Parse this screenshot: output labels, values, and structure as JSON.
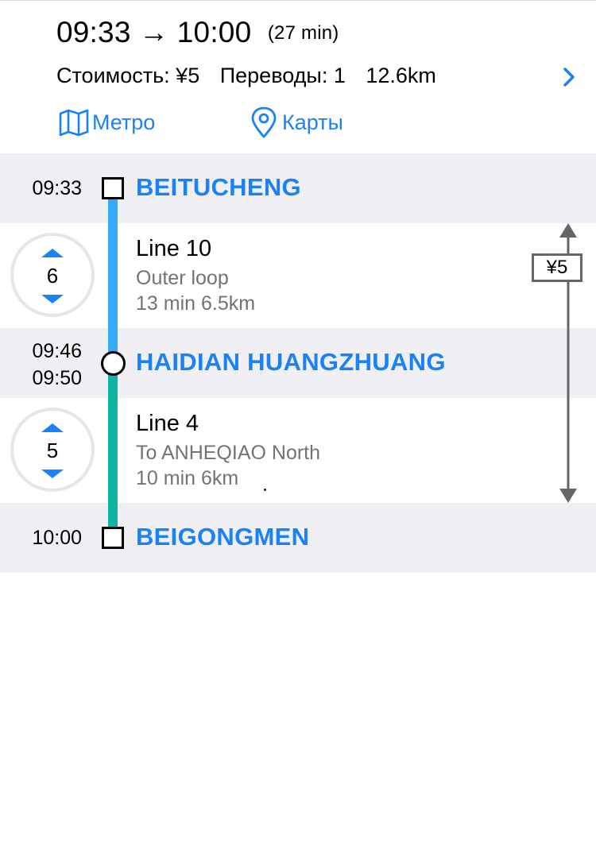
{
  "summary": {
    "departure": "09:33",
    "arrow": "→",
    "arrival": "10:00",
    "duration": "(27 min)",
    "cost": "Стоимость: ¥5",
    "transfers": "Переводы: 1",
    "distance": "12.6km"
  },
  "links": {
    "metro": "Метро",
    "maps": "Карты"
  },
  "stations": [
    {
      "time": "09:33",
      "name": "BEITUCHENG"
    },
    {
      "arrive": "09:46",
      "depart": "09:50",
      "name": "HAIDIAN HUANGZHUANG"
    },
    {
      "time": "10:00",
      "name": "BEIGONGMEN"
    }
  ],
  "segments": [
    {
      "stops": "6",
      "line": "Line 10",
      "direction": "Outer loop",
      "info": "13 min 6.5km",
      "color": "#34aaf8"
    },
    {
      "stops": "5",
      "line": "Line 4",
      "direction": "To ANHEQIAO North",
      "info": "10 min 6km",
      "color": "#11b3a7"
    }
  ],
  "fare": "¥5",
  "accent_color": "#1a82f7"
}
